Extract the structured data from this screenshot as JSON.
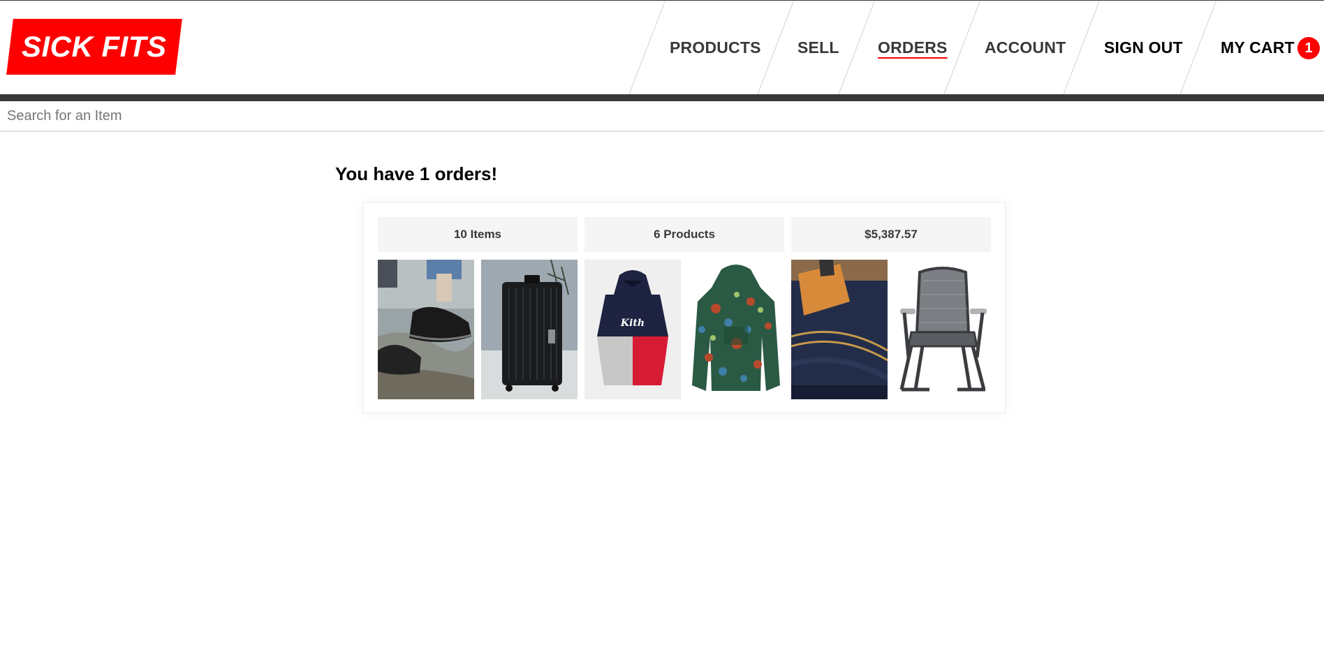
{
  "header": {
    "logo_text": "SICK FITS",
    "nav": {
      "products": "PRODUCTS",
      "sell": "SELL",
      "orders": "ORDERS",
      "account": "ACCOUNT",
      "sign_out": "SIGN OUT",
      "my_cart": "MY CART",
      "cart_count": "1"
    }
  },
  "search": {
    "placeholder": "Search for an Item"
  },
  "main": {
    "title": "You have 1 orders!",
    "order": {
      "items_label": "10 Items",
      "products_label": "6 Products",
      "total": "$5,387.57",
      "thumbnails": [
        "sneakers-photo",
        "suitcase-photo",
        "hoodie-photo",
        "floral-jacket-photo",
        "denim-photo",
        "folding-chair-photo"
      ]
    }
  },
  "colors": {
    "brand": "#ff0000",
    "text": "#393939",
    "bar": "#393939"
  }
}
